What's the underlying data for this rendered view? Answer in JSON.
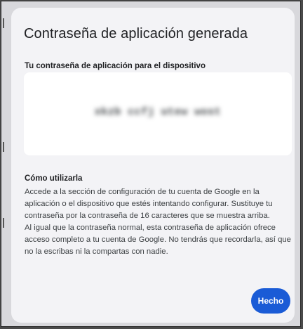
{
  "dialog": {
    "title": "Contraseña de aplicación generada",
    "subtitle": "Tu contraseña de aplicación para el dispositivo",
    "password": "xkzb ccfj utew wost",
    "howto_title": "Cómo utilizarla",
    "howto_paragraph_1": "Accede a la sección de configuración de tu cuenta de Google en la aplicación o el dispositivo que estés intentando configurar. Sustituye tu contraseña por la contraseña de 16 caracteres que se muestra arriba.",
    "howto_paragraph_2": "Al igual que la contraseña normal, esta contraseña de aplicación ofrece acceso completo a tu cuenta de Google. No tendrás que recordarla, así que no la escribas ni la compartas con nadie.",
    "done_label": "Hecho"
  },
  "colors": {
    "accent": "#1a5bd6",
    "dialog_background": "#f3f3f6",
    "password_box": "#ffffff"
  }
}
